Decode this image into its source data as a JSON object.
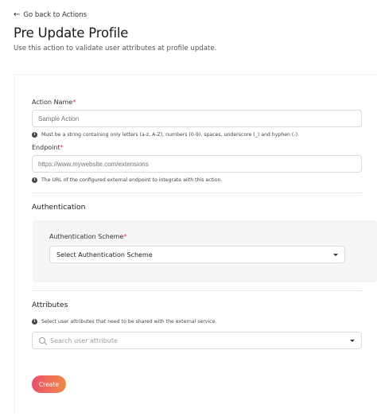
{
  "back_link": {
    "label": "Go back to Actions"
  },
  "page": {
    "title": "Pre Update Profile",
    "subtitle": "Use this action to validate user attributes at profile update."
  },
  "form": {
    "action_name": {
      "label": "Action Name",
      "required_mark": "*",
      "placeholder": "Sample Action",
      "value": "",
      "hint": "Must be a string containing only letters (a-z, A-Z), numbers (0-9), spaces, underscore (_) and hyphen (-)."
    },
    "endpoint": {
      "label": "Endpoint",
      "required_mark": "*",
      "placeholder": "https://www.mywebsite.com/extensions",
      "value": "",
      "hint": "The URL of the configured external endpoint to integrate with this action."
    },
    "authentication": {
      "section_title": "Authentication",
      "scheme_label": "Authentication Scheme",
      "required_mark": "*",
      "selected_value": "Select Authentication Scheme"
    },
    "attributes": {
      "section_title": "Attributes",
      "hint": "Select user attributes that need to be shared with the external service.",
      "search_placeholder": "Search user attribute"
    },
    "create_label": "Create"
  },
  "colors": {
    "accent_start": "#ec4f6c",
    "accent_end": "#f08a44",
    "required": "#e0364d"
  }
}
